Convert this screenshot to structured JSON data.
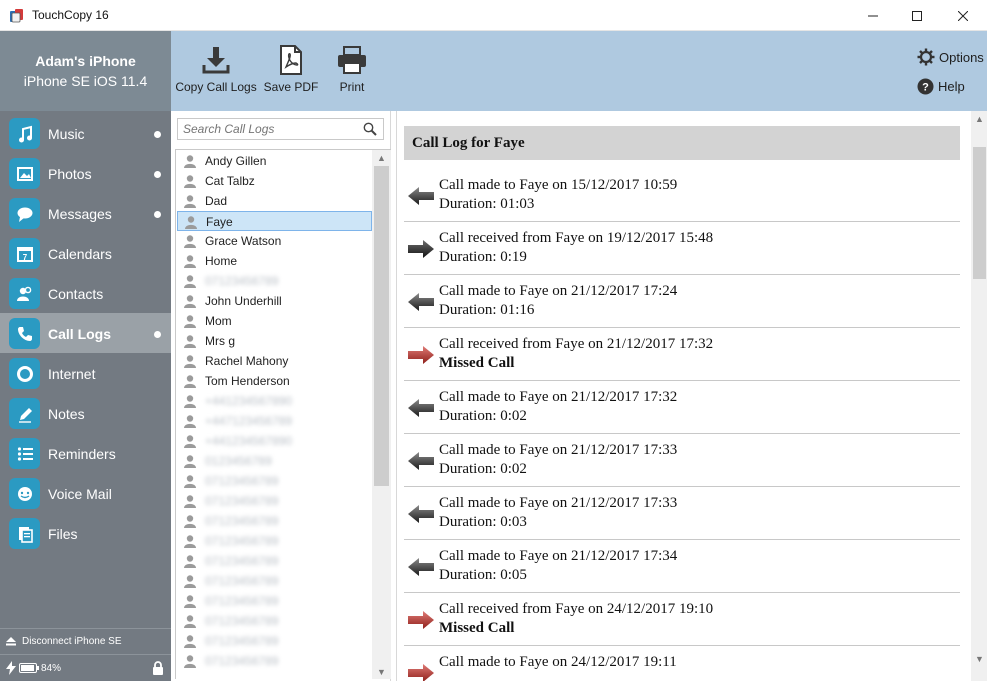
{
  "window": {
    "title": "TouchCopy 16",
    "minimize": "—",
    "maximize": "☐",
    "close": "✕"
  },
  "device": {
    "name": "Adam's iPhone",
    "info": "iPhone SE iOS 11.4"
  },
  "toolbar": {
    "copy_label": "Copy Call Logs",
    "pdf_label": "Save PDF",
    "print_label": "Print",
    "options_label": "Options",
    "help_label": "Help"
  },
  "sidebar": {
    "items": [
      {
        "label": "Music",
        "icon": "music-icon",
        "dot": true
      },
      {
        "label": "Photos",
        "icon": "photos-icon",
        "dot": true
      },
      {
        "label": "Messages",
        "icon": "messages-icon",
        "dot": true
      },
      {
        "label": "Calendars",
        "icon": "calendar-icon",
        "dot": false
      },
      {
        "label": "Contacts",
        "icon": "contacts-icon",
        "dot": false
      },
      {
        "label": "Call Logs",
        "icon": "phone-icon",
        "dot": true,
        "active": true
      },
      {
        "label": "Internet",
        "icon": "internet-icon",
        "dot": false
      },
      {
        "label": "Notes",
        "icon": "notes-icon",
        "dot": false
      },
      {
        "label": "Reminders",
        "icon": "reminders-icon",
        "dot": false
      },
      {
        "label": "Voice Mail",
        "icon": "voicemail-icon",
        "dot": false
      },
      {
        "label": "Files",
        "icon": "files-icon",
        "dot": false
      }
    ],
    "disconnect_label": "Disconnect iPhone SE",
    "battery": "84%"
  },
  "search": {
    "placeholder": "Search Call Logs"
  },
  "contacts": [
    {
      "name": "Andy Gillen"
    },
    {
      "name": "Cat Talbz"
    },
    {
      "name": "Dad"
    },
    {
      "name": "Faye",
      "selected": true
    },
    {
      "name": "Grace Watson"
    },
    {
      "name": "Home"
    },
    {
      "name": "07123456789",
      "blurred": true
    },
    {
      "name": "John Underhill"
    },
    {
      "name": "Mom"
    },
    {
      "name": "Mrs g"
    },
    {
      "name": "Rachel Mahony"
    },
    {
      "name": "Tom Henderson"
    },
    {
      "name": "+441234567890",
      "blurred": true
    },
    {
      "name": "+447123456789",
      "blurred": true
    },
    {
      "name": "+441234567890",
      "blurred": true
    },
    {
      "name": "0123456789",
      "blurred": true
    },
    {
      "name": "07123456789",
      "blurred": true
    },
    {
      "name": "07123456789",
      "blurred": true
    },
    {
      "name": "07123456789",
      "blurred": true
    },
    {
      "name": "07123456789",
      "blurred": true
    },
    {
      "name": "07123456789",
      "blurred": true
    },
    {
      "name": "07123456789",
      "blurred": true
    },
    {
      "name": "07123456789",
      "blurred": true
    },
    {
      "name": "07123456789",
      "blurred": true
    },
    {
      "name": "07123456789",
      "blurred": true
    },
    {
      "name": "07123456789",
      "blurred": true
    }
  ],
  "log": {
    "header": "Call Log for Faye",
    "entries": [
      {
        "line1": "Call made to Faye on 15/12/2017 10:59",
        "line2": "Duration: 01:03",
        "type": "made"
      },
      {
        "line1": "Call received from Faye on 19/12/2017 15:48",
        "line2": "Duration: 0:19",
        "type": "received"
      },
      {
        "line1": "Call made to Faye on 21/12/2017 17:24",
        "line2": "Duration: 01:16",
        "type": "made"
      },
      {
        "line1": "Call received from Faye on 21/12/2017 17:32",
        "line2": "Missed Call",
        "type": "missed"
      },
      {
        "line1": "Call made to Faye on 21/12/2017 17:32",
        "line2": "Duration: 0:02",
        "type": "made"
      },
      {
        "line1": "Call made to Faye on 21/12/2017 17:33",
        "line2": "Duration: 0:02",
        "type": "made"
      },
      {
        "line1": "Call made to Faye on 21/12/2017 17:33",
        "line2": "Duration: 0:03",
        "type": "made"
      },
      {
        "line1": "Call made to Faye on 21/12/2017 17:34",
        "line2": "Duration: 0:05",
        "type": "made"
      },
      {
        "line1": "Call received from Faye on 24/12/2017 19:10",
        "line2": "Missed Call",
        "type": "missed"
      },
      {
        "line1": "Call made to Faye on 24/12/2017 19:11",
        "line2": "",
        "type": "missed"
      }
    ]
  },
  "colors": {
    "accent": "#2b9ac2",
    "sidebar": "#737a82",
    "toolbar": "#afc9e0",
    "missed": "#b0332e"
  }
}
